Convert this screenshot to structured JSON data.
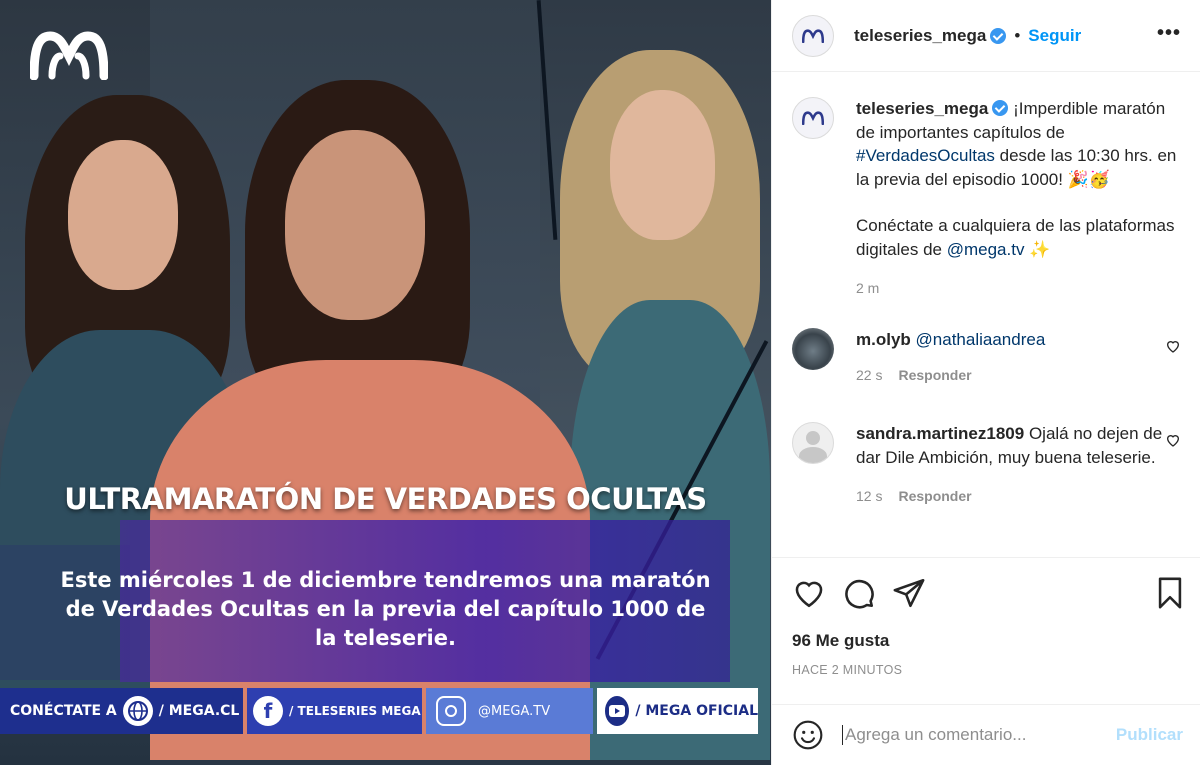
{
  "post_image": {
    "headline": "ULTRAMARATÓN DE VERDADES OCULTAS",
    "subline": "Este miércoles 1 de diciembre tendremos una maratón de Verdades Ocultas en la previa del capítulo 1000 de la teleserie.",
    "footer": {
      "seg1_text": "CONÉCTATE A",
      "seg1_site": "/ MEGA.CL",
      "seg2": "/ TELESERIES MEGA",
      "seg3": "@MEGA.TV",
      "seg4": "/ MEGA OFICIAL"
    },
    "logo_icon": "mega-logo-icon"
  },
  "header": {
    "username": "teleseries_mega",
    "separator": "•",
    "follow_label": "Seguir",
    "more_label": "•••"
  },
  "caption": {
    "username": "teleseries_mega",
    "text_1": "¡Imperdible maratón de importantes capítulos de ",
    "hashtag": "#VerdadesOcultas",
    "text_2": " desde las 10:30 hrs. en la previa del episodio 1000! 🎉🥳",
    "text_3": "Conéctate a cualquiera de las plataformas digitales de ",
    "mention": "@mega.tv",
    "text_4": " ✨",
    "time": "2 m"
  },
  "comments": [
    {
      "username": "m.olyb",
      "mention": "@nathaliaandrea",
      "text": "",
      "time": "22 s",
      "reply_label": "Responder"
    },
    {
      "username": "sandra.martinez1809",
      "mention": "",
      "text": "Ojalá no dejen de dar Dile Ambición, muy buena teleserie.",
      "time": "12 s",
      "reply_label": "Responder"
    }
  ],
  "actions": {
    "likes": "96 Me gusta",
    "time_ago": "HACE 2 MINUTOS"
  },
  "add_comment": {
    "placeholder": "Agrega un comentario...",
    "publish_label": "Publicar"
  },
  "colors": {
    "link_blue": "#0095f6",
    "mention_blue": "#00376b",
    "muted": "#8e8e8e"
  }
}
